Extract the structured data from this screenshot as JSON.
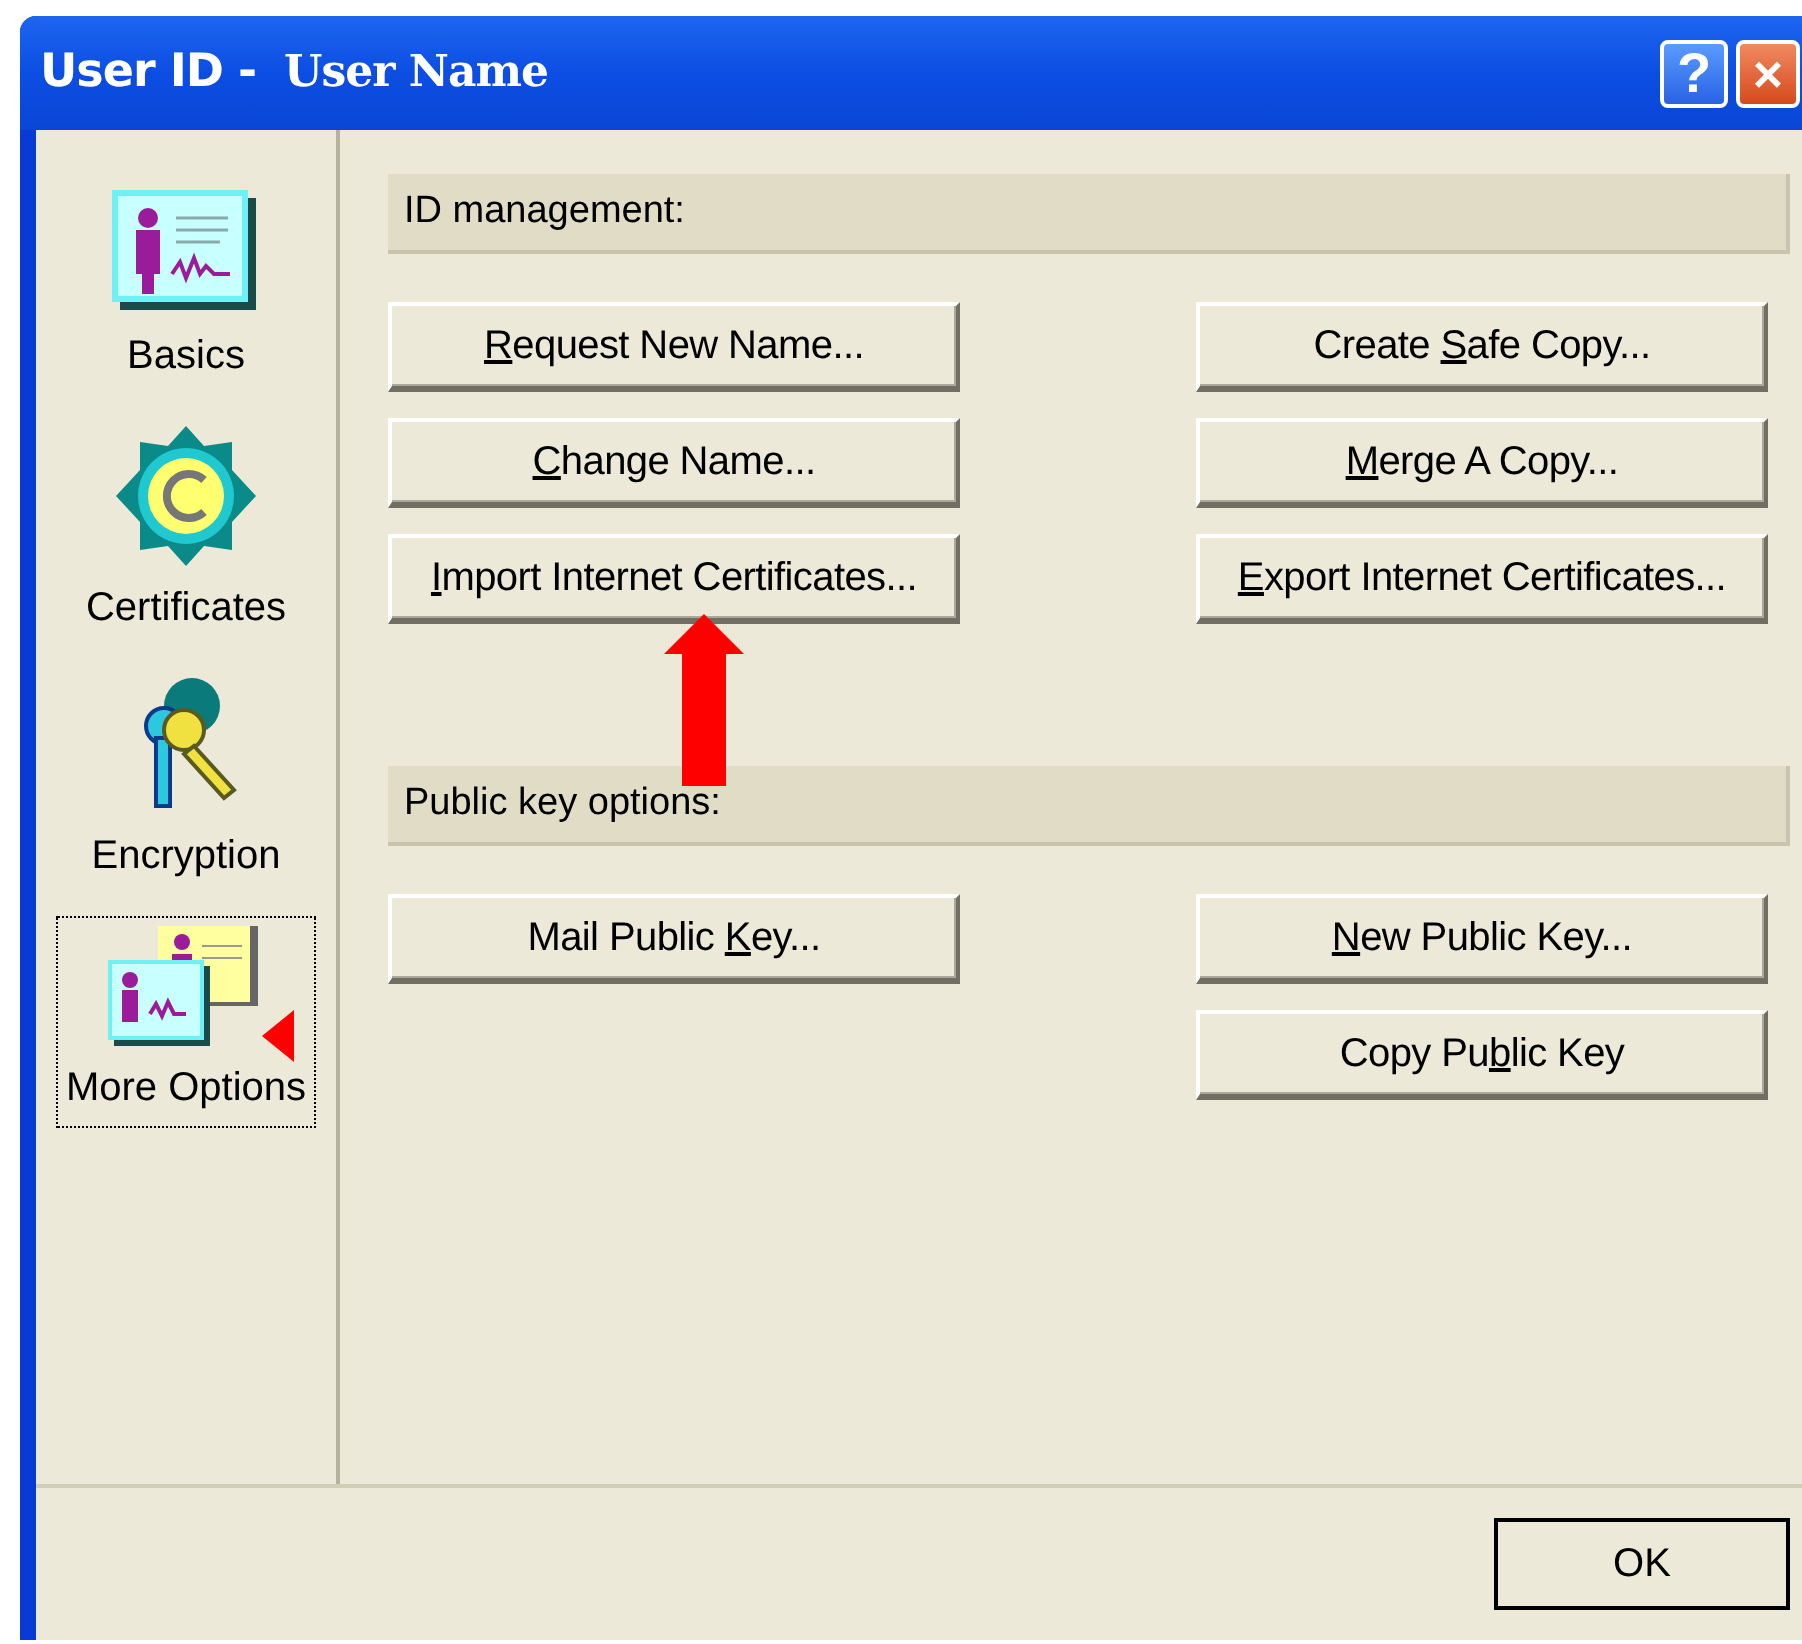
{
  "window": {
    "title_prefix": "User ID -",
    "title_name": "User Name",
    "controls": [
      {
        "kind": "help",
        "label": "?"
      },
      {
        "kind": "close",
        "label": "×"
      }
    ]
  },
  "sidebar": {
    "items": [
      {
        "label": "Basics",
        "kind": "card",
        "selected": false
      },
      {
        "label": "Certificates",
        "kind": "seal",
        "selected": false
      },
      {
        "label": "Encryption",
        "kind": "keys",
        "selected": false
      },
      {
        "label": "More Options",
        "kind": "cards",
        "selected": true
      }
    ]
  },
  "sections": [
    {
      "heading": "ID management:",
      "rows": [
        [
          {
            "parts": [
              {
                "text": "R",
                "underline": true
              },
              {
                "text": "equest New Name...",
                "underline": false
              }
            ]
          },
          {
            "parts": [
              {
                "text": "Create ",
                "underline": false
              },
              {
                "text": "S",
                "underline": true
              },
              {
                "text": "afe Copy...",
                "underline": false
              }
            ]
          }
        ],
        [
          {
            "parts": [
              {
                "text": "C",
                "underline": true
              },
              {
                "text": "hange Name...",
                "underline": false
              }
            ]
          },
          {
            "parts": [
              {
                "text": "M",
                "underline": true
              },
              {
                "text": "erge A Copy...",
                "underline": false
              }
            ]
          }
        ],
        [
          {
            "parts": [
              {
                "text": "I",
                "underline": true
              },
              {
                "text": "mport Internet Certificates...",
                "underline": false
              }
            ]
          },
          {
            "parts": [
              {
                "text": "E",
                "underline": true
              },
              {
                "text": "xport Internet Certificates...",
                "underline": false
              }
            ]
          }
        ]
      ]
    },
    {
      "heading": "Public key options:",
      "rows": [
        [
          {
            "parts": [
              {
                "text": "Mail Public ",
                "underline": false
              },
              {
                "text": "K",
                "underline": true
              },
              {
                "text": "ey...",
                "underline": false
              }
            ]
          },
          {
            "parts": [
              {
                "text": "N",
                "underline": true
              },
              {
                "text": "ew Public Key...",
                "underline": false
              }
            ]
          }
        ],
        [
          null,
          {
            "parts": [
              {
                "text": "Copy Pu",
                "underline": false
              },
              {
                "text": "b",
                "underline": true
              },
              {
                "text": "lic Key",
                "underline": false
              }
            ]
          }
        ]
      ]
    }
  ],
  "footer": {
    "buttons": [
      {
        "label": "OK"
      }
    ]
  }
}
